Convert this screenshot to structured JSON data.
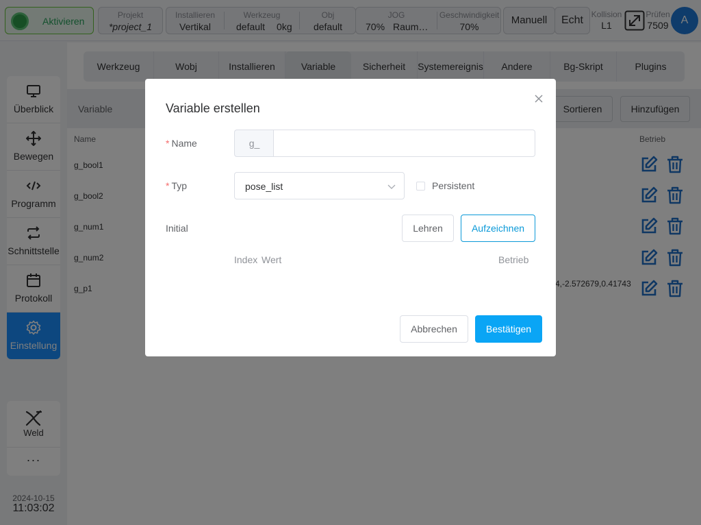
{
  "topbar": {
    "activate_label": "Aktivieren",
    "project": {
      "caption": "Projekt",
      "value": "*project_1"
    },
    "install": {
      "caption": "Installieren",
      "value": "Vertikal"
    },
    "tool": {
      "caption": "Werkzeug",
      "value": "default",
      "load": "0kg"
    },
    "obj": {
      "caption": "Obj",
      "value": "default"
    },
    "jog": {
      "caption": "JOG",
      "value": "70%",
      "frame": "Raum…"
    },
    "speed": {
      "caption": "Geschwindigkeit",
      "value": "70%"
    },
    "manual_label": "Manuell",
    "real_label": "Echt",
    "collision": {
      "caption": "Kollision",
      "value": "L1"
    },
    "check": {
      "caption": "Prüfen",
      "value": "7509"
    },
    "avatar": "A"
  },
  "sidebar": {
    "items": [
      {
        "label": "Überblick",
        "icon": "monitor-icon"
      },
      {
        "label": "Bewegen",
        "icon": "move-icon"
      },
      {
        "label": "Programm",
        "icon": "code-icon"
      },
      {
        "label": "Schnittstelle",
        "icon": "exchange-icon"
      },
      {
        "label": "Protokoll",
        "icon": "calendar-icon"
      },
      {
        "label": "Einstellung",
        "icon": "gear-icon"
      }
    ],
    "weld_label": "Weld",
    "more_label": "···",
    "date": "2024-10-15",
    "time": "11:03:02"
  },
  "tabs": [
    "Werkzeug",
    "Wobj",
    "Installieren",
    "Variable",
    "Sicherheit",
    "Systemereignis",
    "Andere",
    "Bg-Skript",
    "Plugins"
  ],
  "subbar": {
    "title": "Variable",
    "sort_label": "Sortieren",
    "add_label": "Hinzufügen"
  },
  "table": {
    "headers": {
      "name": "Name",
      "action": "Betrieb"
    },
    "rows": [
      {
        "name": "g_bool1",
        "value": ""
      },
      {
        "name": "g_bool2",
        "value": ""
      },
      {
        "name": "g_num1",
        "value": ""
      },
      {
        "name": "g_num2",
        "value": ""
      },
      {
        "name": "g_p1",
        "value": "4,-2.572679,0.41743"
      }
    ]
  },
  "modal": {
    "title": "Variable erstellen",
    "name_label": "Name",
    "name_prefix": "g_",
    "name_value": "",
    "type_label": "Typ",
    "type_value": "pose_list",
    "persistent_label": "Persistent",
    "initial_label": "Initial",
    "teach_label": "Lehren",
    "record_label": "Aufzeichnen",
    "col_index": "Index",
    "col_value": "Wert",
    "col_action": "Betrieb",
    "cancel_label": "Abbrechen",
    "confirm_label": "Bestätigen"
  },
  "colors": {
    "accent": "#0aa5f5",
    "sidebar_active": "#1a8fff",
    "success": "#27a15a",
    "icon_blue": "#1e6fc7"
  }
}
